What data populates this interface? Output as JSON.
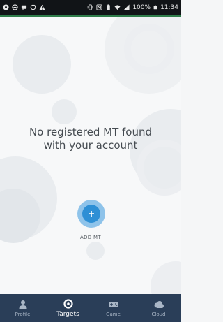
{
  "status_bar": {
    "battery": "100%",
    "time": "11:34",
    "left_icons": [
      "settings-icon",
      "minus-circle-icon",
      "message-icon",
      "sync-icon",
      "warning-icon"
    ],
    "right_icons": [
      "vibrate-icon",
      "nfc-icon",
      "battery-saver-icon",
      "wifi-icon",
      "signal-icon",
      "battery-icon"
    ]
  },
  "main": {
    "empty_message_line1": "No registered MT found",
    "empty_message_line2": "with your account",
    "add_label": "ADD MT",
    "add_icon": "plus-icon"
  },
  "bottom_nav": {
    "items": [
      {
        "label": "Profile",
        "icon": "person-icon",
        "active": false
      },
      {
        "label": "Targets",
        "icon": "target-icon",
        "active": true
      },
      {
        "label": "Game",
        "icon": "gamepad-icon",
        "active": false
      },
      {
        "label": "Cloud",
        "icon": "cloud-icon",
        "active": false
      }
    ]
  },
  "colors": {
    "status_bar": "#111417",
    "status_accent": "#2f7d4a",
    "background": "#f7f8f9",
    "accent": "#2d8fd5",
    "accent_halo": "#8ec3ea",
    "nav_background": "#2a3e58",
    "nav_active": "#ffffff",
    "nav_inactive": "#a9b6c6"
  }
}
